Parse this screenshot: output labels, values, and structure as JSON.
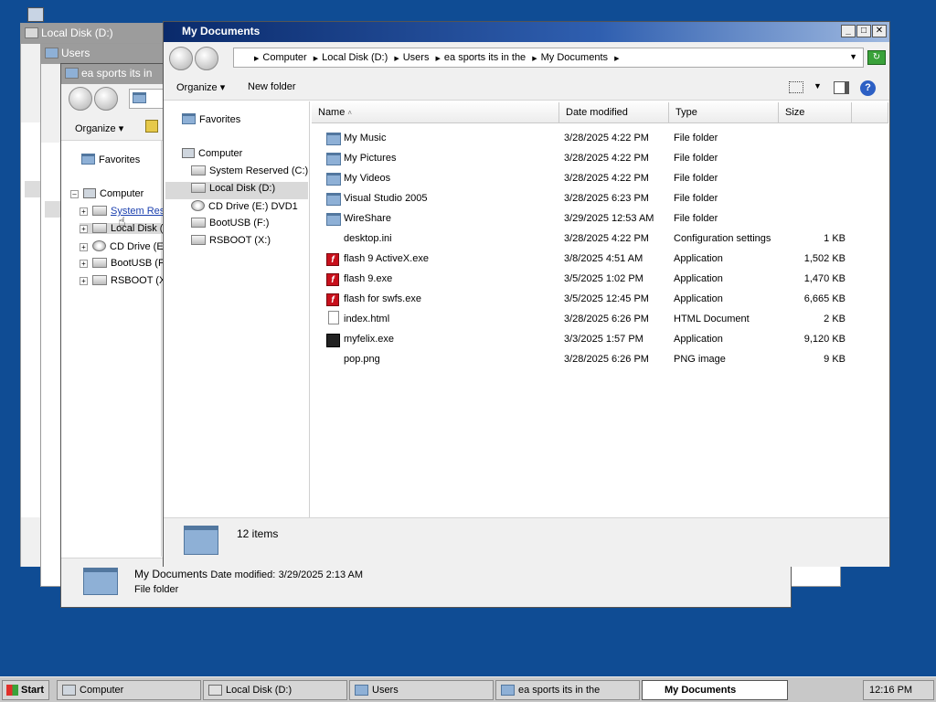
{
  "windows": {
    "back1": {
      "title": "Local Disk (D:)"
    },
    "back2": {
      "title": "Users"
    },
    "back3": {
      "title": "ea sports its in",
      "organize_label": "Organize",
      "favorites_label": "Favorites",
      "computer_label": "Computer",
      "tree": [
        "System Res",
        "Local Disk (I",
        "CD Drive (E",
        "BootUSB (F",
        "RSBOOT (X"
      ],
      "details": {
        "name": "My Documents",
        "date_label": "Date modified:",
        "date_value": "3/29/2025 2:13 AM",
        "type": "File folder"
      }
    },
    "main": {
      "title": "My Documents",
      "breadcrumb": [
        "Computer",
        "Local Disk (D:)",
        "Users",
        "ea sports its in the",
        "My Documents"
      ],
      "toolbar": {
        "organize_label": "Organize",
        "new_folder_label": "New folder"
      },
      "nav": {
        "favorites_label": "Favorites",
        "computer_label": "Computer",
        "drives": [
          "System Reserved (C:)",
          "Local Disk (D:)",
          "CD Drive (E:) DVD1",
          "BootUSB (F:)",
          "RSBOOT (X:)"
        ]
      },
      "columns": {
        "name": "Name",
        "date": "Date modified",
        "type": "Type",
        "size": "Size"
      },
      "files": [
        {
          "name": "My Music",
          "date": "3/28/2025 4:22 PM",
          "type": "File folder",
          "size": "",
          "icon": "folder-icon"
        },
        {
          "name": "My Pictures",
          "date": "3/28/2025 4:22 PM",
          "type": "File folder",
          "size": "",
          "icon": "folder-icon"
        },
        {
          "name": "My Videos",
          "date": "3/28/2025 4:22 PM",
          "type": "File folder",
          "size": "",
          "icon": "folder-icon"
        },
        {
          "name": "Visual Studio 2005",
          "date": "3/28/2025 6:23 PM",
          "type": "File folder",
          "size": "",
          "icon": "folder-icon"
        },
        {
          "name": "WireShare",
          "date": "3/29/2025 12:53 AM",
          "type": "File folder",
          "size": "",
          "icon": "folder-icon"
        },
        {
          "name": "desktop.ini",
          "date": "3/28/2025 4:22 PM",
          "type": "Configuration settings",
          "size": "1 KB",
          "icon": "blank-icon"
        },
        {
          "name": "flash 9 ActiveX.exe",
          "date": "3/8/2025 4:51 AM",
          "type": "Application",
          "size": "1,502 KB",
          "icon": "flash-icon"
        },
        {
          "name": "flash 9.exe",
          "date": "3/5/2025 1:02 PM",
          "type": "Application",
          "size": "1,470 KB",
          "icon": "flash-icon"
        },
        {
          "name": "flash for swfs.exe",
          "date": "3/5/2025 12:45 PM",
          "type": "Application",
          "size": "6,665 KB",
          "icon": "flash-icon"
        },
        {
          "name": "index.html",
          "date": "3/28/2025 6:26 PM",
          "type": "HTML Document",
          "size": "2 KB",
          "icon": "file-icon"
        },
        {
          "name": "myfelix.exe",
          "date": "3/3/2025 1:57 PM",
          "type": "Application",
          "size": "9,120 KB",
          "icon": "felix-icon"
        },
        {
          "name": "pop.png",
          "date": "3/28/2025 6:26 PM",
          "type": "PNG image",
          "size": "9 KB",
          "icon": "blank-icon"
        }
      ],
      "status": {
        "count": "12 items"
      }
    }
  },
  "taskbar": {
    "start_label": "Start",
    "items": [
      "Computer",
      "Local Disk (D:)",
      "Users",
      "ea sports its in the",
      "My Documents"
    ],
    "clock": "12:16 PM"
  }
}
